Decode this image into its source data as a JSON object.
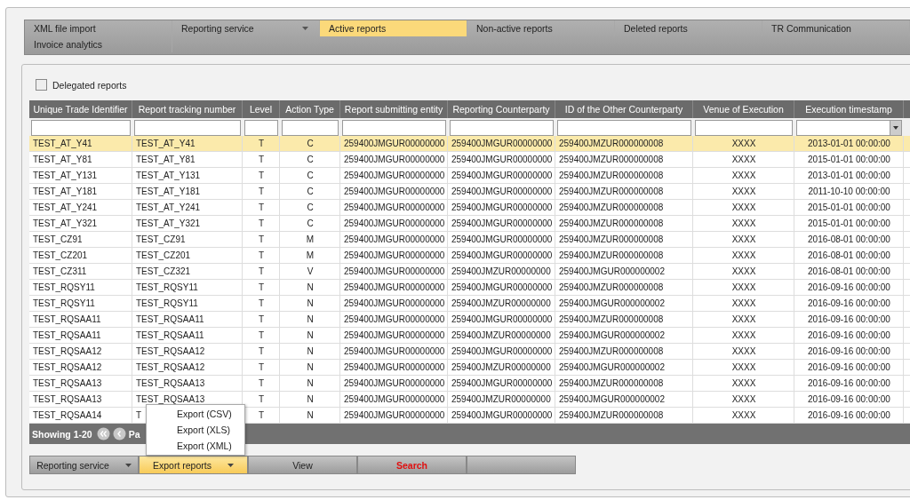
{
  "tabs": [
    {
      "label": "XML file import",
      "selected": false,
      "dropdown": false
    },
    {
      "label": "Reporting service",
      "selected": false,
      "dropdown": true
    },
    {
      "label": "Active reports",
      "selected": true,
      "dropdown": false
    },
    {
      "label": "Non-active reports",
      "selected": false,
      "dropdown": false
    },
    {
      "label": "Deleted reports",
      "selected": false,
      "dropdown": false
    },
    {
      "label": "TR Communication",
      "selected": false,
      "dropdown": false
    },
    {
      "label": "Invoice analytics",
      "selected": false,
      "dropdown": false
    }
  ],
  "delegated": {
    "label": "Delegated reports",
    "checked": false
  },
  "table": {
    "columns": [
      {
        "label": "Unique Trade Identifier"
      },
      {
        "label": "Report tracking number"
      },
      {
        "label": "Level"
      },
      {
        "label": "Action Type"
      },
      {
        "label": "Report submitting entity"
      },
      {
        "label": "Reporting Counterparty"
      },
      {
        "label": "ID of the Other Counterparty"
      },
      {
        "label": "Venue of Execution"
      },
      {
        "label": "Execution timestamp"
      }
    ],
    "rows": [
      {
        "selected": true,
        "cells": [
          "TEST_AT_Y41",
          "TEST_AT_Y41",
          "T",
          "C",
          "259400JMGUR00000000",
          "259400JMGUR00000000",
          "259400JMZUR000000008",
          "XXXX",
          "2013-01-01 00:00:00"
        ]
      },
      {
        "selected": false,
        "cells": [
          "TEST_AT_Y81",
          "TEST_AT_Y81",
          "T",
          "C",
          "259400JMGUR00000000",
          "259400JMGUR00000000",
          "259400JMZUR000000008",
          "XXXX",
          "2015-01-01 00:00:00"
        ]
      },
      {
        "selected": false,
        "cells": [
          "TEST_AT_Y131",
          "TEST_AT_Y131",
          "T",
          "C",
          "259400JMGUR00000000",
          "259400JMGUR00000000",
          "259400JMZUR000000008",
          "XXXX",
          "2013-01-01 00:00:00"
        ]
      },
      {
        "selected": false,
        "cells": [
          "TEST_AT_Y181",
          "TEST_AT_Y181",
          "T",
          "C",
          "259400JMGUR00000000",
          "259400JMGUR00000000",
          "259400JMZUR000000008",
          "XXXX",
          "2011-10-10 00:00:00"
        ]
      },
      {
        "selected": false,
        "cells": [
          "TEST_AT_Y241",
          "TEST_AT_Y241",
          "T",
          "C",
          "259400JMGUR00000000",
          "259400JMGUR00000000",
          "259400JMZUR000000008",
          "XXXX",
          "2015-01-01 00:00:00"
        ]
      },
      {
        "selected": false,
        "cells": [
          "TEST_AT_Y321",
          "TEST_AT_Y321",
          "T",
          "C",
          "259400JMGUR00000000",
          "259400JMGUR00000000",
          "259400JMZUR000000008",
          "XXXX",
          "2015-01-01 00:00:00"
        ]
      },
      {
        "selected": false,
        "cells": [
          "TEST_CZ91",
          "TEST_CZ91",
          "T",
          "M",
          "259400JMGUR00000000",
          "259400JMGUR00000000",
          "259400JMZUR000000008",
          "XXXX",
          "2016-08-01 00:00:00"
        ]
      },
      {
        "selected": false,
        "cells": [
          "TEST_CZ201",
          "TEST_CZ201",
          "T",
          "M",
          "259400JMGUR00000000",
          "259400JMGUR00000000",
          "259400JMZUR000000008",
          "XXXX",
          "2016-08-01 00:00:00"
        ]
      },
      {
        "selected": false,
        "cells": [
          "TEST_CZ311",
          "TEST_CZ321",
          "T",
          "V",
          "259400JMGUR00000000",
          "259400JMZUR00000000",
          "259400JMGUR000000002",
          "XXXX",
          "2016-08-01 00:00:00"
        ]
      },
      {
        "selected": false,
        "cells": [
          "TEST_RQSY11",
          "TEST_RQSY11",
          "T",
          "N",
          "259400JMGUR00000000",
          "259400JMGUR00000000",
          "259400JMZUR000000008",
          "XXXX",
          "2016-09-16 00:00:00"
        ]
      },
      {
        "selected": false,
        "cells": [
          "TEST_RQSY11",
          "TEST_RQSY11",
          "T",
          "N",
          "259400JMGUR00000000",
          "259400JMZUR00000000",
          "259400JMGUR000000002",
          "XXXX",
          "2016-09-16 00:00:00"
        ]
      },
      {
        "selected": false,
        "cells": [
          "TEST_RQSAA11",
          "TEST_RQSAA11",
          "T",
          "N",
          "259400JMGUR00000000",
          "259400JMGUR00000000",
          "259400JMZUR000000008",
          "XXXX",
          "2016-09-16 00:00:00"
        ]
      },
      {
        "selected": false,
        "cells": [
          "TEST_RQSAA11",
          "TEST_RQSAA11",
          "T",
          "N",
          "259400JMGUR00000000",
          "259400JMZUR00000000",
          "259400JMGUR000000002",
          "XXXX",
          "2016-09-16 00:00:00"
        ]
      },
      {
        "selected": false,
        "cells": [
          "TEST_RQSAA12",
          "TEST_RQSAA12",
          "T",
          "N",
          "259400JMGUR00000000",
          "259400JMGUR00000000",
          "259400JMZUR000000008",
          "XXXX",
          "2016-09-16 00:00:00"
        ]
      },
      {
        "selected": false,
        "cells": [
          "TEST_RQSAA12",
          "TEST_RQSAA12",
          "T",
          "N",
          "259400JMGUR00000000",
          "259400JMZUR00000000",
          "259400JMGUR000000002",
          "XXXX",
          "2016-09-16 00:00:00"
        ]
      },
      {
        "selected": false,
        "cells": [
          "TEST_RQSAA13",
          "TEST_RQSAA13",
          "T",
          "N",
          "259400JMGUR00000000",
          "259400JMGUR00000000",
          "259400JMZUR000000008",
          "XXXX",
          "2016-09-16 00:00:00"
        ]
      },
      {
        "selected": false,
        "cells": [
          "TEST_RQSAA13",
          "TEST_RQSAA13",
          "T",
          "N",
          "259400JMGUR00000000",
          "259400JMZUR00000000",
          "259400JMGUR000000002",
          "XXXX",
          "2016-09-16 00:00:00"
        ]
      },
      {
        "selected": false,
        "cells": [
          "TEST_RQSAA14",
          "T",
          "T",
          "N",
          "259400JMGUR00000000",
          "259400JMGUR00000000",
          "259400JMZUR000000008",
          "XXXX",
          "2016-09-16 00:00:00"
        ]
      }
    ]
  },
  "pager": {
    "showing": "Showing 1-20",
    "page": "Pa"
  },
  "export_menu": [
    "Export (CSV)",
    "Export (XLS)",
    "Export (XML)"
  ],
  "buttons": [
    {
      "label": "Reporting service",
      "kind": "dropdown",
      "selected": false
    },
    {
      "label": "Export reports",
      "kind": "dropdown",
      "selected": true
    },
    {
      "label": "View",
      "kind": "plain",
      "selected": false
    },
    {
      "label": "Search",
      "kind": "danger",
      "selected": false
    },
    {
      "kind": "blank",
      "selected": false
    }
  ]
}
